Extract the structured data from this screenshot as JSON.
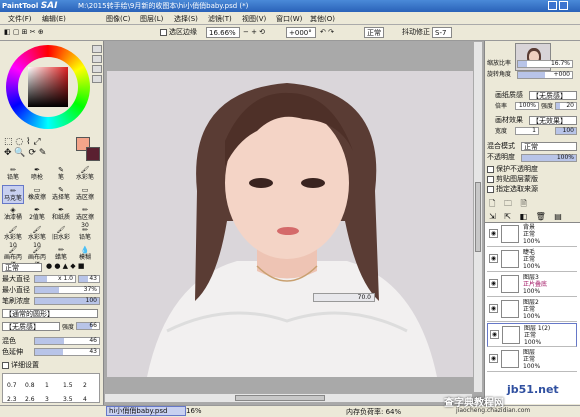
{
  "app": {
    "logo_text": "PaintTool",
    "logo_brand": "SAI",
    "window_title": "M:\\2015转手绘\\9月新的收图本\\hi小俏俏baby.psd (*)"
  },
  "menu": [
    "文件(F)",
    "编辑(E)",
    "图像(C)",
    "图层(L)",
    "选择(S)",
    "滤镜(T)",
    "视图(V)",
    "窗口(W)",
    "其他(O)"
  ],
  "toolbar": {
    "selection_edge_label": "选区边缘",
    "zoom": "16.66%",
    "rotation": "+000°",
    "blend": "正常",
    "stabilizer_label": "抖动修正",
    "stabilizer_value": "S-7"
  },
  "left": {
    "tools_row1": [
      "铅笔",
      "喷枪",
      "笔",
      "水彩笔"
    ],
    "tools_row2": [
      "马克笔",
      "橡皮擦",
      "选择笔",
      "选区擦"
    ],
    "tools_row3": [
      "油漆桶",
      "2值笔",
      "和纸质",
      "选区擦30"
    ],
    "tools_row4": [
      "水彩笔10",
      "水彩笔10",
      "旧水彩",
      "铅笔"
    ],
    "tools_row5": [
      "画布丙烯",
      "画布丙烯",
      "蜡笔",
      "模糊"
    ],
    "mode": "正常",
    "max_diameter_label": "最大直径",
    "max_diameter_value": "x 1.0",
    "max_diameter_num": "43",
    "min_diameter_label": "最小直径",
    "min_diameter_value": "37%",
    "density_label": "笔刷浓度",
    "density_value": "100",
    "shape_label": "【通常的圆形】",
    "texture_label": "【无质感】",
    "strength_label": "强度",
    "strength_value": "66",
    "mix_label": "混色",
    "mix_value": "46",
    "dilution_label": "色延伸",
    "dilution_value": "43",
    "detail_label": "详细设置",
    "sizes": [
      "0.7",
      "0.8",
      "1",
      "1.5",
      "2",
      "2.3",
      "2.6",
      "3",
      "3.5",
      "4"
    ]
  },
  "canvas": {
    "tag_value": "70.0"
  },
  "right": {
    "nav_zoom_label": "缩放比率",
    "nav_zoom_value": "16.7%",
    "nav_rotate_label": "旋转角度",
    "nav_rotate_value": "+000",
    "texture_label": "画纸质感",
    "texture_value": "【无质感】",
    "scale_label": "倍率",
    "scale_value": "100%",
    "strength_label": "强度",
    "strength_value": "20",
    "effect_label": "画材效果",
    "effect_value": "【无效果】",
    "width_label": "宽度",
    "width_value": "1",
    "strength2_value": "100",
    "blend_label": "混合模式",
    "blend_value": "正常",
    "opacity_label": "不透明度",
    "opacity_value": "100%",
    "protect_label": "保护不透明度",
    "clip_label": "剪贴图层蒙版",
    "ref_label": "指定选取来源",
    "layers": [
      {
        "name": "背景",
        "mode": "正常",
        "opacity": "100%"
      },
      {
        "name": "睫毛",
        "mode": "正常",
        "opacity": "100%"
      },
      {
        "name": "图层3",
        "mode": "正片叠底",
        "opacity": "100%"
      },
      {
        "name": "图层2",
        "mode": "正常",
        "opacity": "100%"
      },
      {
        "name": "图层 1(2)",
        "mode": "正常",
        "opacity": "100%"
      },
      {
        "name": "图层",
        "mode": "正常",
        "opacity": "100%"
      }
    ]
  },
  "status": {
    "tab_label": "hi小俏俏baby.psd",
    "tab_zoom": "16%",
    "memory": "内存负荷率: 64%",
    "watermark1": "jb51.net",
    "watermark2": "查字典教程网",
    "watermark3": "jiaocheng.chazidian.com"
  },
  "colors": {
    "fg": "#f4a48a",
    "bg": "#5a2030",
    "accent": "#c8d0f0"
  }
}
